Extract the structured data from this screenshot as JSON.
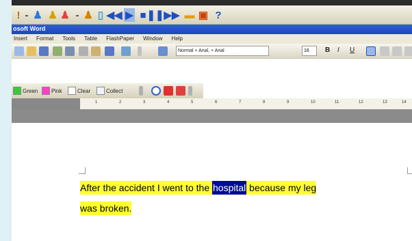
{
  "title_bar": {
    "text": "osoft Word"
  },
  "menu": [
    "Insert",
    "Format",
    "Tools",
    "Table",
    "FlashPaper",
    "Window",
    "Help"
  ],
  "style_box": {
    "value": "Normal + Arial, + Arial"
  },
  "size_box": {
    "value": "16"
  },
  "format_buttons": {
    "bold": "B",
    "italic": "I",
    "underline": "U"
  },
  "highlight_toolbar": {
    "green": "Green",
    "pink": "Pink",
    "clear": "Clear",
    "collect": "Collect"
  },
  "ruler": {
    "numbers": [
      "1",
      "2",
      "3",
      "4",
      "5",
      "6",
      "7",
      "8",
      "9",
      "10",
      "11",
      "12",
      "13",
      "14"
    ]
  },
  "document": {
    "before": "After the accident I went to the ",
    "selected": "hospital",
    "after": " because my leg",
    "line2": "was broken."
  },
  "colors": {
    "highlight": "#ffff2e",
    "selection": "#000a99",
    "title_bar": "#2f5fd0"
  }
}
